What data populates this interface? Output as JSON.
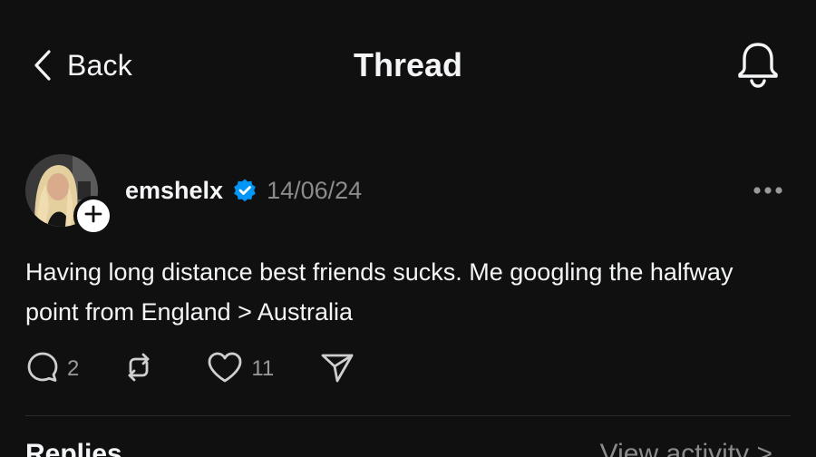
{
  "header": {
    "back_label": "Back",
    "title": "Thread",
    "back_icon": "chevron-left-icon",
    "notify_icon": "bell-icon"
  },
  "post": {
    "username": "emshelx",
    "verified": true,
    "date": "14/06/24",
    "text": "Having long distance best friends sucks. Me googling the halfway point from England > Australia",
    "actions": {
      "reply_count": "2",
      "like_count": "11"
    }
  },
  "replies_section": {
    "label": "Replies",
    "view_activity": "View activity >"
  },
  "colors": {
    "background": "#101010",
    "text": "#f3f5f7",
    "muted": "#8b8b8b",
    "verified": "#0095f6"
  }
}
